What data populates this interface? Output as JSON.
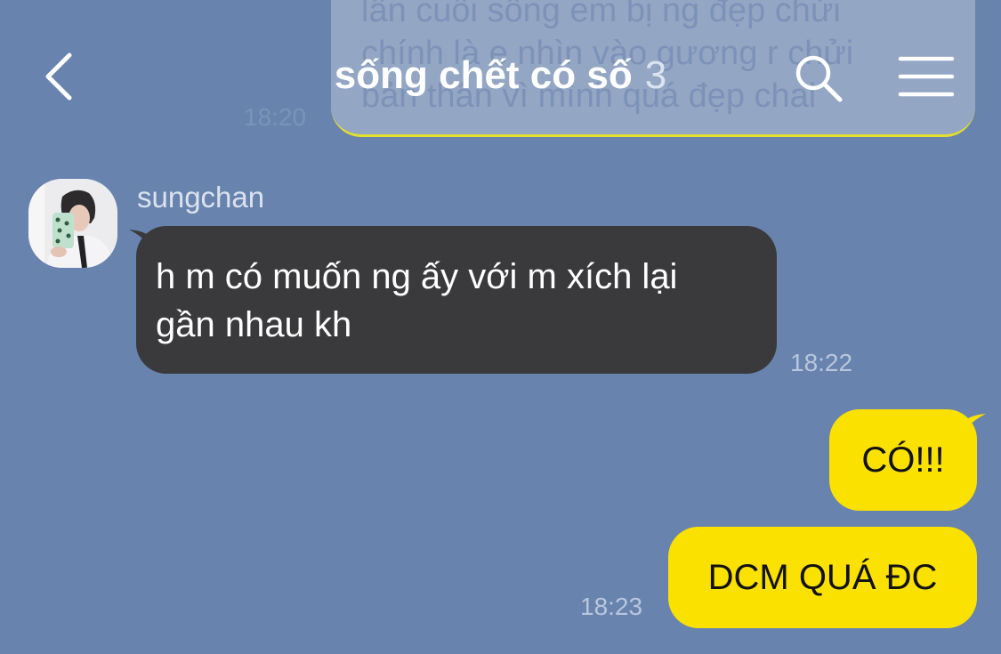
{
  "header": {
    "title": "sống chết có số",
    "member_count": "3"
  },
  "faded_message": {
    "lines": [
      "lần cuối sống em bị ng đẹp chửi",
      "chính là e nhìn vào gương r chửi",
      "bản thân vì mình quá đẹp chai"
    ],
    "time": "18:20"
  },
  "messages": {
    "received": {
      "sender": "sungchan",
      "line1": "h m có muốn ng ấy với m xích lại",
      "line2": "gần nhau kh",
      "time": "18:22"
    },
    "sent": [
      {
        "text": "CÓ!!!"
      },
      {
        "text": "DCM QUÁ ĐC"
      }
    ],
    "sent_time": "18:23"
  },
  "colors": {
    "background": "#6883ae",
    "sent_bubble": "#fae100",
    "received_bubble": "#3a3a3c"
  },
  "icons": {
    "back": "chevron-left-icon",
    "search": "search-icon",
    "menu": "hamburger-menu-icon"
  }
}
